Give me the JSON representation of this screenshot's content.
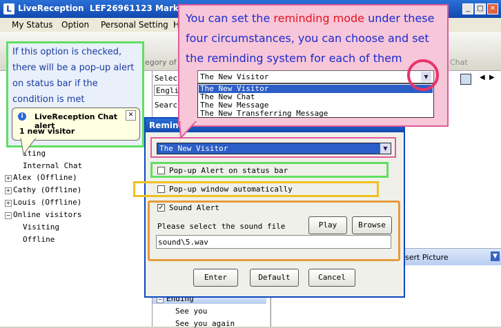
{
  "window": {
    "app_icon": "livereception-logo",
    "title": "LiveReception  LEF26961123 Mark",
    "buttons": [
      "minimize",
      "maximize",
      "close"
    ]
  },
  "menu": [
    "My Status",
    "Option",
    "Personal Setting",
    "H"
  ],
  "toolbar": {
    "fragment_left": "egory of",
    "fragment_right": "Chat"
  },
  "tip": {
    "text": "If this option is checked, there will be a pop-up alert on status bar if the condition is met",
    "balloon_title": "LiveReception Chat alert",
    "balloon_body": "1 new visitor"
  },
  "top_note": {
    "before": "You can set the ",
    "highlight": "reminding mode",
    "after": " under these four circumstances, you can choose and set the reminding system for each of them"
  },
  "mode_dropdown": {
    "selected": "The New Visitor",
    "options": [
      "The New Visitor",
      "The New Chat",
      "The New Message",
      "The New Transferring Message"
    ]
  },
  "left_tree": {
    "items": [
      "iting",
      "Internal Chat",
      "Alex (Offline)",
      "Cathy (Offline)",
      "Louis (Offline)",
      "Online visitors",
      "Visiting",
      "Offline"
    ]
  },
  "mid_panel": {
    "select_label": "Select",
    "lang_value": "Engli",
    "search_label": "Search",
    "ending_label": "Ending",
    "see_you": "See you",
    "see_you_again": "See you again"
  },
  "right_panel": {
    "insert_picture": "sert Picture"
  },
  "dialog": {
    "title": "Remind",
    "mode_selected": "The New Visitor",
    "popup_alert_label": "Pop-up Alert on status bar",
    "popup_window_label": "Pop-up window automatically",
    "sound_alert_label": "Sound Alert",
    "sound_file_prompt": "Please select the sound file",
    "sound_file_value": "sound\\5.wav",
    "play_label": "Play",
    "browse_label": "Browse",
    "enter_label": "Enter",
    "default_label": "Default",
    "cancel_label": "Cancel",
    "popup_alert_checked": false,
    "popup_window_checked": false,
    "sound_alert_checked": true
  },
  "colors": {
    "green_box": "#5fde5f",
    "pink_box": "#e05a9a",
    "yellow_box": "#f0c020",
    "orange_box": "#e69a3c",
    "note_text": "#1a2bd0",
    "note_highlight": "#e8131f"
  }
}
